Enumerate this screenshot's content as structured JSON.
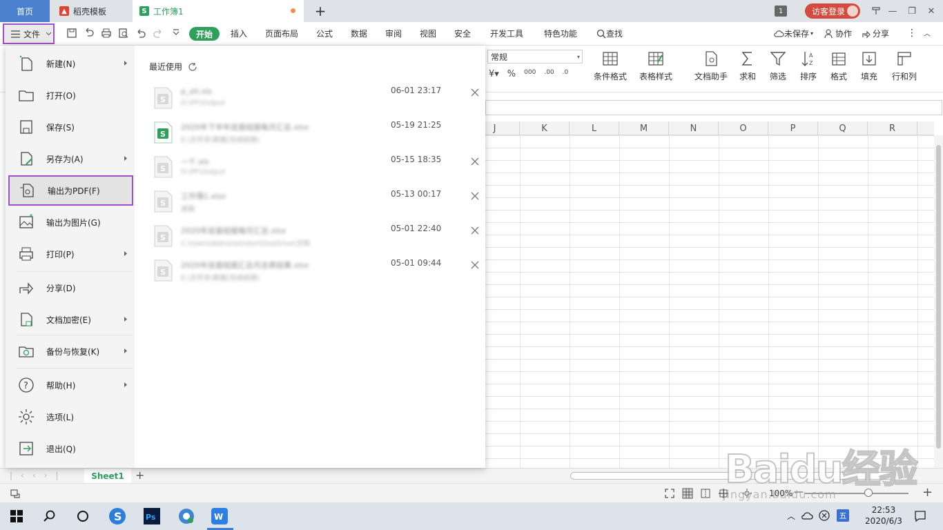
{
  "tabs": {
    "home": "首页",
    "daoke": "稻壳模板",
    "workbook": "工作簿1",
    "window_count": "1",
    "login": "访客登录"
  },
  "toolbar": {
    "file": "文件",
    "ribbon_tabs": [
      "开始",
      "插入",
      "页面布局",
      "公式",
      "数据",
      "审阅",
      "视图",
      "安全",
      "开发工具",
      "特色功能"
    ],
    "search": "查找",
    "unsaved": "未保存",
    "collab": "协作",
    "share": "分享"
  },
  "ribbon": {
    "number_format": "常规",
    "buttons": [
      "条件格式",
      "表格样式",
      "文档助手",
      "求和",
      "筛选",
      "排序",
      "格式",
      "填充",
      "行和列"
    ]
  },
  "columns": [
    "J",
    "K",
    "L",
    "M",
    "N",
    "O",
    "P",
    "Q",
    "R"
  ],
  "file_menu": {
    "items": [
      {
        "label": "新建(N)",
        "icon": "new-file-icon",
        "submenu": true
      },
      {
        "label": "打开(O)",
        "icon": "folder-open-icon",
        "submenu": false
      },
      {
        "label": "保存(S)",
        "icon": "save-icon",
        "submenu": false
      },
      {
        "label": "另存为(A)",
        "icon": "save-as-icon",
        "submenu": true
      },
      {
        "label": "输出为PDF(F)",
        "icon": "export-pdf-icon",
        "submenu": false
      },
      {
        "label": "输出为图片(G)",
        "icon": "export-image-icon",
        "submenu": false
      },
      {
        "label": "打印(P)",
        "icon": "print-icon",
        "submenu": true
      },
      {
        "label": "分享(D)",
        "icon": "share-icon",
        "submenu": false
      },
      {
        "label": "文档加密(E)",
        "icon": "encrypt-icon",
        "submenu": true
      },
      {
        "label": "备份与恢复(K)",
        "icon": "backup-icon",
        "submenu": true
      },
      {
        "label": "帮助(H)",
        "icon": "help-icon",
        "submenu": true
      },
      {
        "label": "选项(L)",
        "icon": "settings-icon",
        "submenu": false
      },
      {
        "label": "退出(Q)",
        "icon": "exit-icon",
        "submenu": false
      }
    ],
    "recent_title": "最近使用",
    "recent_files": [
      {
        "name": "p_eh.xls",
        "path": "D:\\PF\\Output",
        "date": "06-01 23:17",
        "type": "gray"
      },
      {
        "name": "2020年下半年巡查结报每月汇总.xlsx",
        "path": "E:\\文件夹\\数据(完成结报)",
        "date": "05-19 21:25",
        "type": "green"
      },
      {
        "name": "一个.xls",
        "path": "D:\\PF\\Output",
        "date": "05-15 18:35",
        "type": "gray"
      },
      {
        "name": "工作簿1.xlsx",
        "path": "桌面",
        "date": "05-13 00:17",
        "type": "gray"
      },
      {
        "name": "2020年巡查结报每月汇总.xlsx",
        "path": "C:\\Users\\Administrator\\OneDrive\\文档",
        "date": "05-01 22:40",
        "type": "gray"
      },
      {
        "name": "2020年巡查结报汇总月总表结果.xlsx",
        "path": "E:\\文件夹\\数据(完成结报)",
        "date": "05-01 09:44",
        "type": "gray"
      }
    ]
  },
  "sheet": {
    "tab": "Sheet1"
  },
  "status": {
    "zoom": "100%"
  },
  "taskbar": {
    "ime": "五",
    "time": "22:53",
    "date": "2020/6/3"
  },
  "watermark": {
    "logo": "Baidu经验",
    "url": "jingyan.baidu.com"
  },
  "colors": {
    "accent": "#2fa05b",
    "tab_blue": "#4b80cf",
    "login_red": "#d24b3e",
    "highlight": "#a050c8"
  }
}
